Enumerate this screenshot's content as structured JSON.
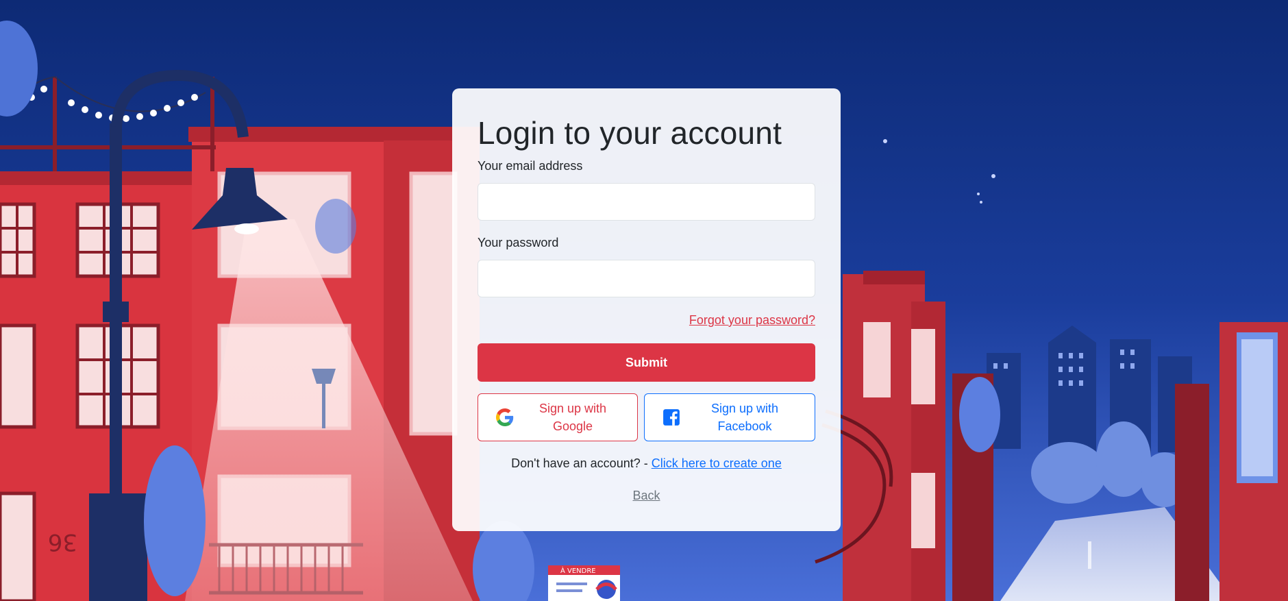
{
  "login": {
    "title": "Login to your account",
    "email_label": "Your email address",
    "email_value": "",
    "password_label": "Your password",
    "password_value": "",
    "forgot_link": "Forgot your password?",
    "submit_label": "Submit",
    "google_label": "Sign up with Google",
    "facebook_label": "Sign up with Facebook",
    "signup_prompt": "Don't have an account? - ",
    "signup_link": "Click here to create one",
    "back_link": "Back"
  },
  "background": {
    "sign_text": "À VENDRE",
    "door_number": "36"
  },
  "colors": {
    "primary_red": "#dc3545",
    "facebook_blue": "#0d6efd",
    "card_bg": "#ffffff",
    "sky": "#0f2d78"
  },
  "icons": {
    "google": "google-icon",
    "facebook": "facebook-icon"
  }
}
